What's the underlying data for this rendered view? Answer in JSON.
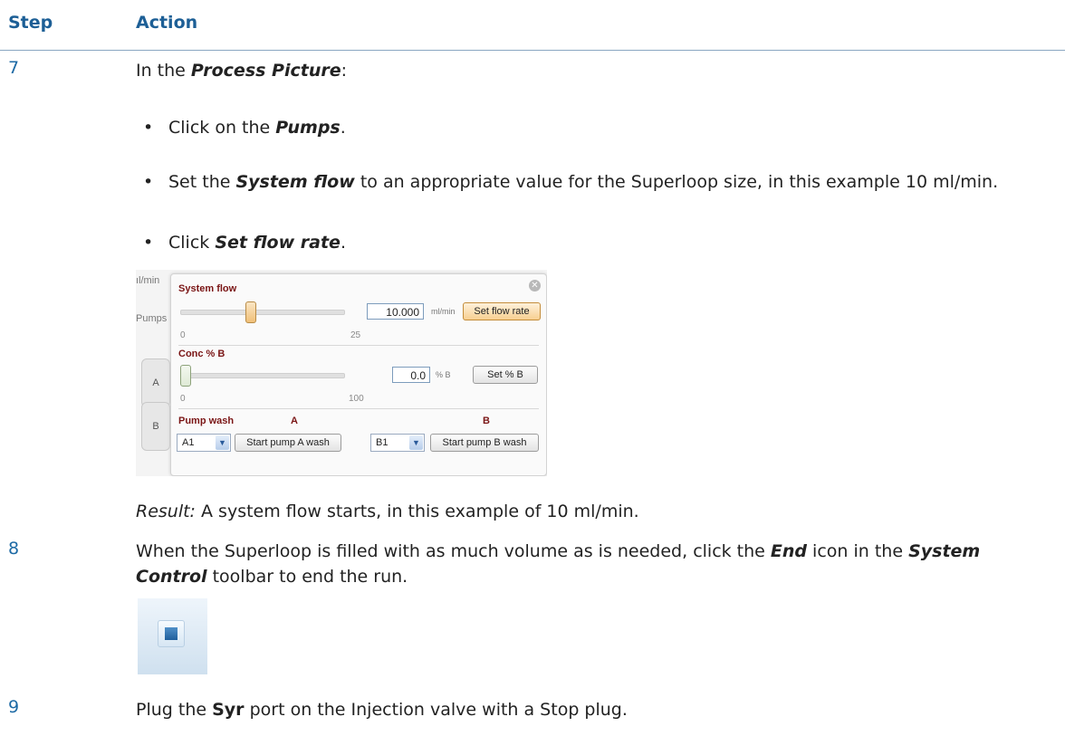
{
  "header": {
    "step": "Step",
    "action": "Action"
  },
  "steps": [
    {
      "num": "7",
      "intro_a": "In the ",
      "intro_em": "Process Picture",
      "intro_b": ":",
      "b1_a": "Click on the ",
      "b1_em": "Pumps",
      "b1_b": ".",
      "b2_a": "Set the ",
      "b2_em": "System flow",
      "b2_b": " to an appropriate value for the Superloop size, in this example 10 ml/min.",
      "b3_a": "Click ",
      "b3_em": "Set flow rate",
      "b3_b": ".",
      "result_label": "Result:",
      "result_text": " A system flow starts, in this example of 10 ml/min."
    },
    {
      "num": "8",
      "a": "When the Superloop is filled with as much volume as is needed, click the ",
      "em1": "End",
      "b": " icon in the ",
      "em2": "System Control",
      "c": " toolbar to end the run."
    },
    {
      "num": "9",
      "a": "Plug the ",
      "strong": "Syr",
      "b": " port on the Injection valve with a Stop plug."
    }
  ],
  "screenshot": {
    "bg_unit": "ıl/min",
    "bg_pumps": "Pumps",
    "side_a": "A",
    "side_b": "B",
    "system_flow_label": "System flow",
    "flow_value": "10.000",
    "flow_unit": "ml/min",
    "set_flow_button": "Set flow rate",
    "flow_min": "0",
    "flow_max": "25",
    "flow_level_fraction": 0.4,
    "conc_label": "Conc % B",
    "conc_value": "0.0",
    "conc_unit": "% B",
    "set_conc_button": "Set % B",
    "conc_min": "0",
    "conc_max": "100",
    "conc_level_fraction": 0.0,
    "pump_wash_label": "Pump wash",
    "col_a": "A",
    "col_b": "B",
    "select_a": "A1",
    "select_b": "B1",
    "start_a_button": "Start pump A wash",
    "start_b_button": "Start pump B wash"
  },
  "colors": {
    "heading": "#1d5f96",
    "accent_label": "#7a1515"
  }
}
